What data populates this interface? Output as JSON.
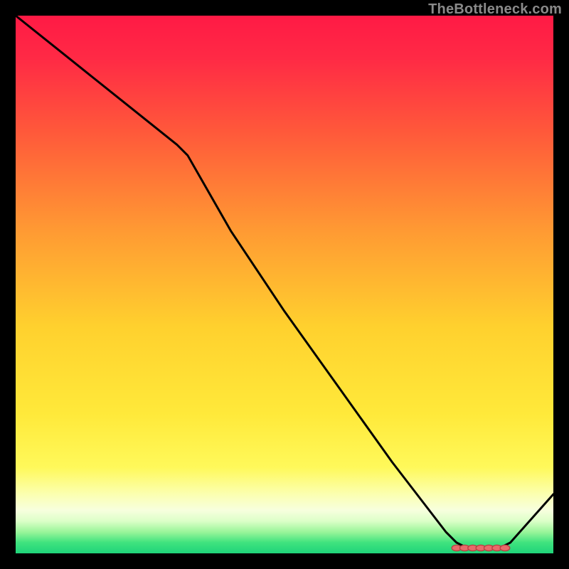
{
  "watermark": "TheBottleneck.com",
  "colors": {
    "bg": "#000000",
    "line": "#000000",
    "marker_fill": "#e86a6a",
    "marker_stroke": "#b74242",
    "gradient_stops": [
      {
        "pct": 0,
        "color": "#ff1a45"
      },
      {
        "pct": 8,
        "color": "#ff2a45"
      },
      {
        "pct": 22,
        "color": "#ff5a3a"
      },
      {
        "pct": 40,
        "color": "#ff9a33"
      },
      {
        "pct": 58,
        "color": "#ffd12e"
      },
      {
        "pct": 74,
        "color": "#ffe93a"
      },
      {
        "pct": 84,
        "color": "#fff95a"
      },
      {
        "pct": 89,
        "color": "#fbffb0"
      },
      {
        "pct": 92,
        "color": "#f7ffde"
      },
      {
        "pct": 94,
        "color": "#dcffc8"
      },
      {
        "pct": 96,
        "color": "#9af59a"
      },
      {
        "pct": 98,
        "color": "#3fe37e"
      },
      {
        "pct": 100,
        "color": "#1fd47a"
      }
    ]
  },
  "chart_data": {
    "type": "line",
    "title": "",
    "xlabel": "",
    "ylabel": "",
    "xlim": [
      0,
      100
    ],
    "ylim": [
      0,
      100
    ],
    "x": [
      0,
      10,
      20,
      30,
      32,
      40,
      50,
      60,
      70,
      80,
      82,
      84,
      86,
      88,
      90,
      92,
      100
    ],
    "values": [
      100,
      92,
      84,
      76,
      74,
      60,
      45,
      31,
      17,
      4,
      2,
      1,
      1,
      1,
      1,
      2,
      11
    ],
    "markers": {
      "x": [
        82,
        83.5,
        85,
        86.5,
        88,
        89.5,
        91
      ],
      "values": [
        1,
        1,
        1,
        1,
        1,
        1,
        1
      ]
    }
  }
}
